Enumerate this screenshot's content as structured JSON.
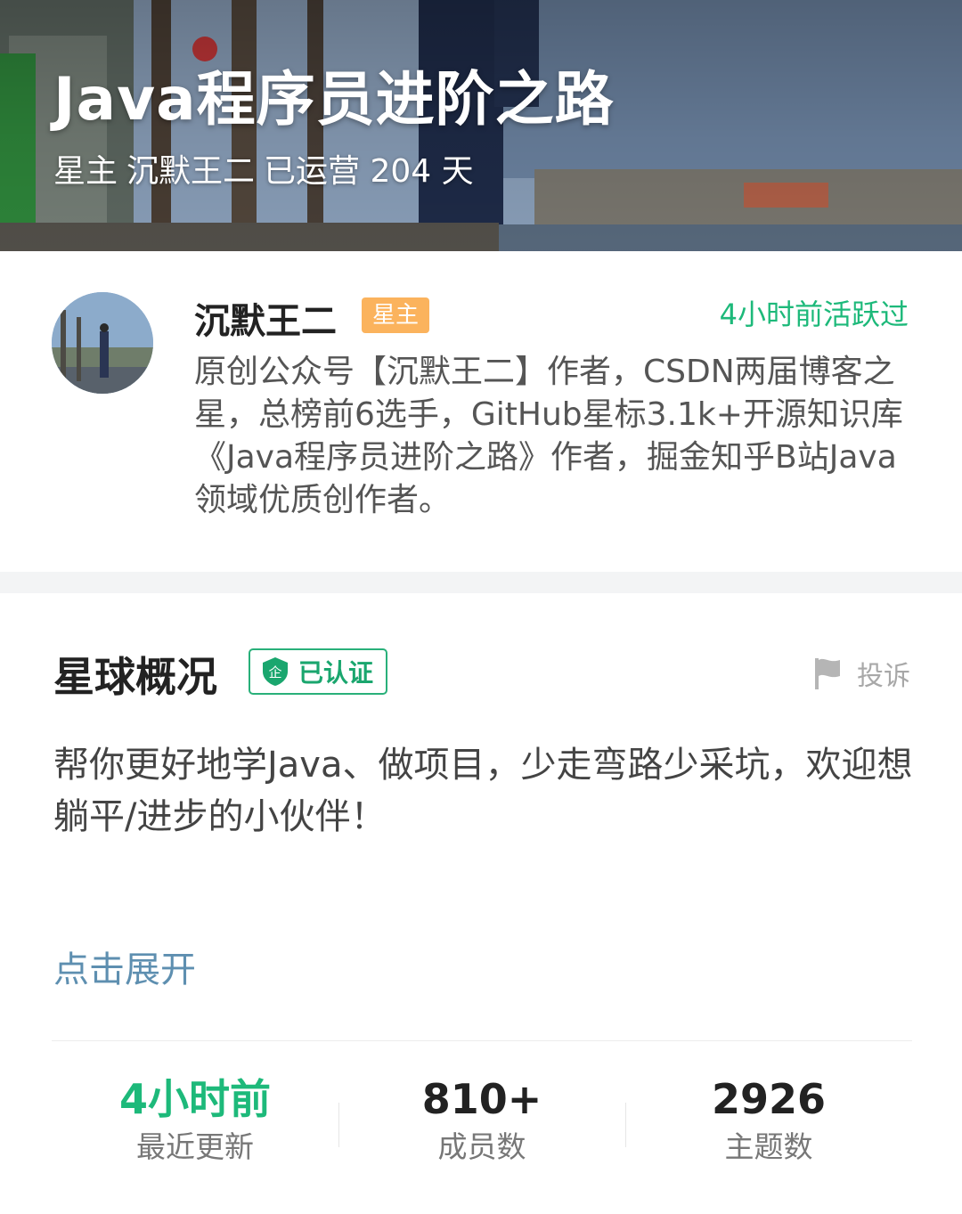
{
  "hero": {
    "title": "Java程序员进阶之路",
    "owner_role": "星主",
    "owner_name": "沉默王二",
    "operating_text": "已运营 204 天"
  },
  "owner": {
    "name": "沉默王二",
    "badge": "星主",
    "last_active": "4小时前活跃过",
    "bio": "原创公众号【沉默王二】作者，CSDN两届博客之星，总榜前6选手，GitHub星标3.1k+开源知识库《Java程序员进阶之路》作者，掘金知乎B站Java领域优质创作者。"
  },
  "overview": {
    "title": "星球概况",
    "verified_icon_text": "企",
    "verified_label": "已认证",
    "report_label": "投诉",
    "description": "帮你更好地学Java、做项目，少走弯路少采坑，欢迎想躺平/进步的小伙伴！",
    "expand_label": "点击展开"
  },
  "stats": [
    {
      "value": "4小时前",
      "label": "最近更新"
    },
    {
      "value": "810+",
      "label": "成员数"
    },
    {
      "value": "2926",
      "label": "主题数"
    }
  ],
  "colors": {
    "accent_green": "#1db97a",
    "badge_orange": "#fbb35d",
    "link_blue": "#5e8fb0"
  },
  "icons": {
    "verified": "enterprise-shield-icon",
    "report": "flag-icon"
  }
}
